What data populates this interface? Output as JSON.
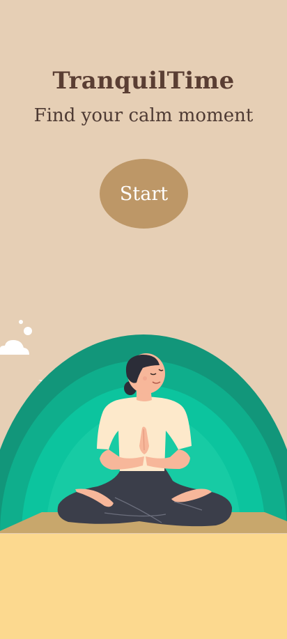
{
  "app": {
    "title": "TranquilTime",
    "tagline": "Find your calm moment"
  },
  "actions": {
    "start_label": "Start"
  },
  "illustration": {
    "subject": "meditating-woman",
    "colors": {
      "background": "#E6CFB5",
      "button": "#BD9767",
      "arc_outer": "#12967A",
      "arc_2": "#0FAE8C",
      "arc_3": "#0CC49E",
      "arc_inner": "#17CBA4",
      "mat": "#C8A76C",
      "floor": "#FCD98F",
      "shirt": "#FDE9CB",
      "pants": "#3B3E4A",
      "skin": "#F7B79A",
      "hair": "#2B2D38"
    }
  }
}
